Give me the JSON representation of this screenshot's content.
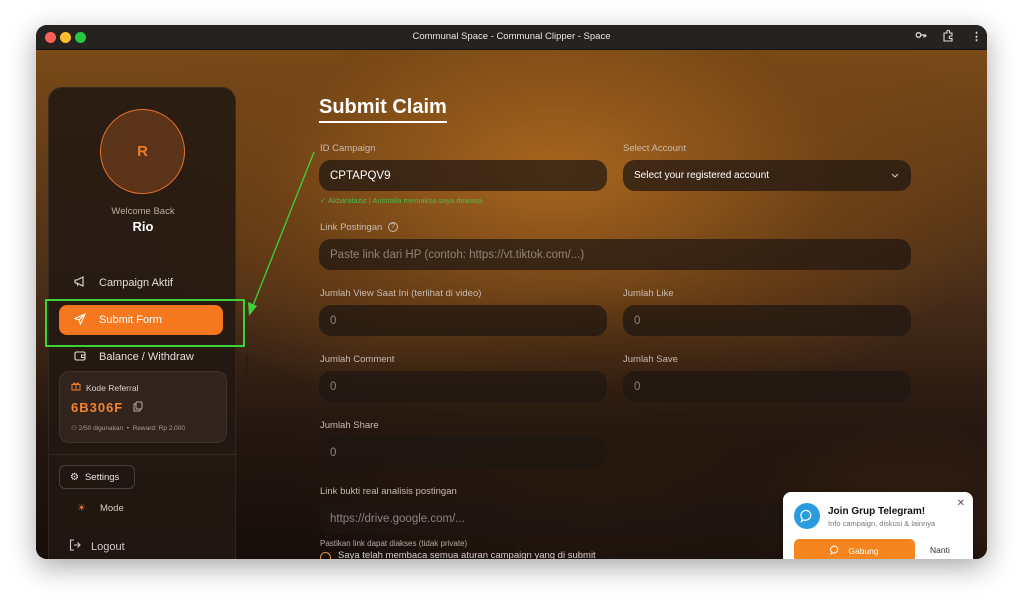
{
  "window": {
    "title": "Communal Space - Communal Clipper - Space",
    "icons": [
      "key-icon",
      "extension-icon",
      "more-vertical-icon"
    ]
  },
  "colors": {
    "accent": "#f5781e",
    "highlight_box": "#3fd13a",
    "hint_green": "#4dbb4a",
    "telegram_blue": "#2a9be0"
  },
  "sidebar": {
    "avatar_initial": "R",
    "welcome": "Welcome Back",
    "user": "Rio",
    "nav": [
      {
        "label": "Campaign Aktif",
        "icon": "megaphone-icon"
      },
      {
        "label": "Submit Form",
        "icon": "send-icon",
        "active": true
      },
      {
        "label": "Balance / Withdraw",
        "icon": "wallet-icon"
      }
    ],
    "referral": {
      "title": "Kode Referral",
      "code": "6B306F",
      "used": "2/50 digunakan",
      "reward": "Reward: Rp 2.000"
    },
    "settings_label": "Settings",
    "mode_label": "Mode",
    "logout_label": "Logout"
  },
  "form": {
    "title": "Submit Claim",
    "id_campaign": {
      "label": "ID Campaign",
      "value": "CPTAPQV9"
    },
    "campaign_hint": "✓ Akbaralaziz | Australia memaksa saya dewasa",
    "select_account": {
      "label": "Select Account",
      "value": "Select your registered account"
    },
    "link_postingan": {
      "label": "Link Postingan",
      "placeholder": "Paste link dari HP (contoh: https://vt.tiktok.com/...)"
    },
    "jumlah_view": {
      "label": "Jumlah View Saat Ini (terlihat di video)",
      "value": "0"
    },
    "jumlah_like": {
      "label": "Jumlah Like",
      "value": "0"
    },
    "jumlah_comment": {
      "label": "Jumlah Comment",
      "value": "0"
    },
    "jumlah_save": {
      "label": "Jumlah Save",
      "value": "0"
    },
    "jumlah_share": {
      "label": "Jumlah Share",
      "value": "0"
    },
    "link_bukti": {
      "label": "Link bukti real analisis postingan",
      "placeholder": "https://drive.google.com/...",
      "hint": "Pastikan link dapat diakses (tidak private)"
    },
    "agreement": "Saya telah membaca semua aturan campaign yang di submit"
  },
  "toast": {
    "title": "Join Grup Telegram!",
    "subtitle": "Info campaign, diskusi & lainnya",
    "join_label": "Gabung",
    "later_label": "Nanti"
  }
}
